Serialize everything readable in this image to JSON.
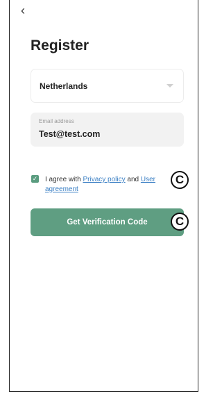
{
  "header": {
    "back_glyph": "‹",
    "title": "Register"
  },
  "country": {
    "selected": "Netherlands",
    "icon": "chevron-down-icon"
  },
  "email": {
    "label": "Email address",
    "value": "Test@test.com"
  },
  "agreement": {
    "checked": true,
    "prefix": "I agree with ",
    "privacy_link": "Privacy policy",
    "middle": " and ",
    "user_link": "User agreement"
  },
  "verify_button": {
    "label": "Get Verification Code"
  },
  "callouts": {
    "c1": "C",
    "c2": "C"
  },
  "colors": {
    "accent": "#5f9e82",
    "link": "#3a7fc4"
  }
}
